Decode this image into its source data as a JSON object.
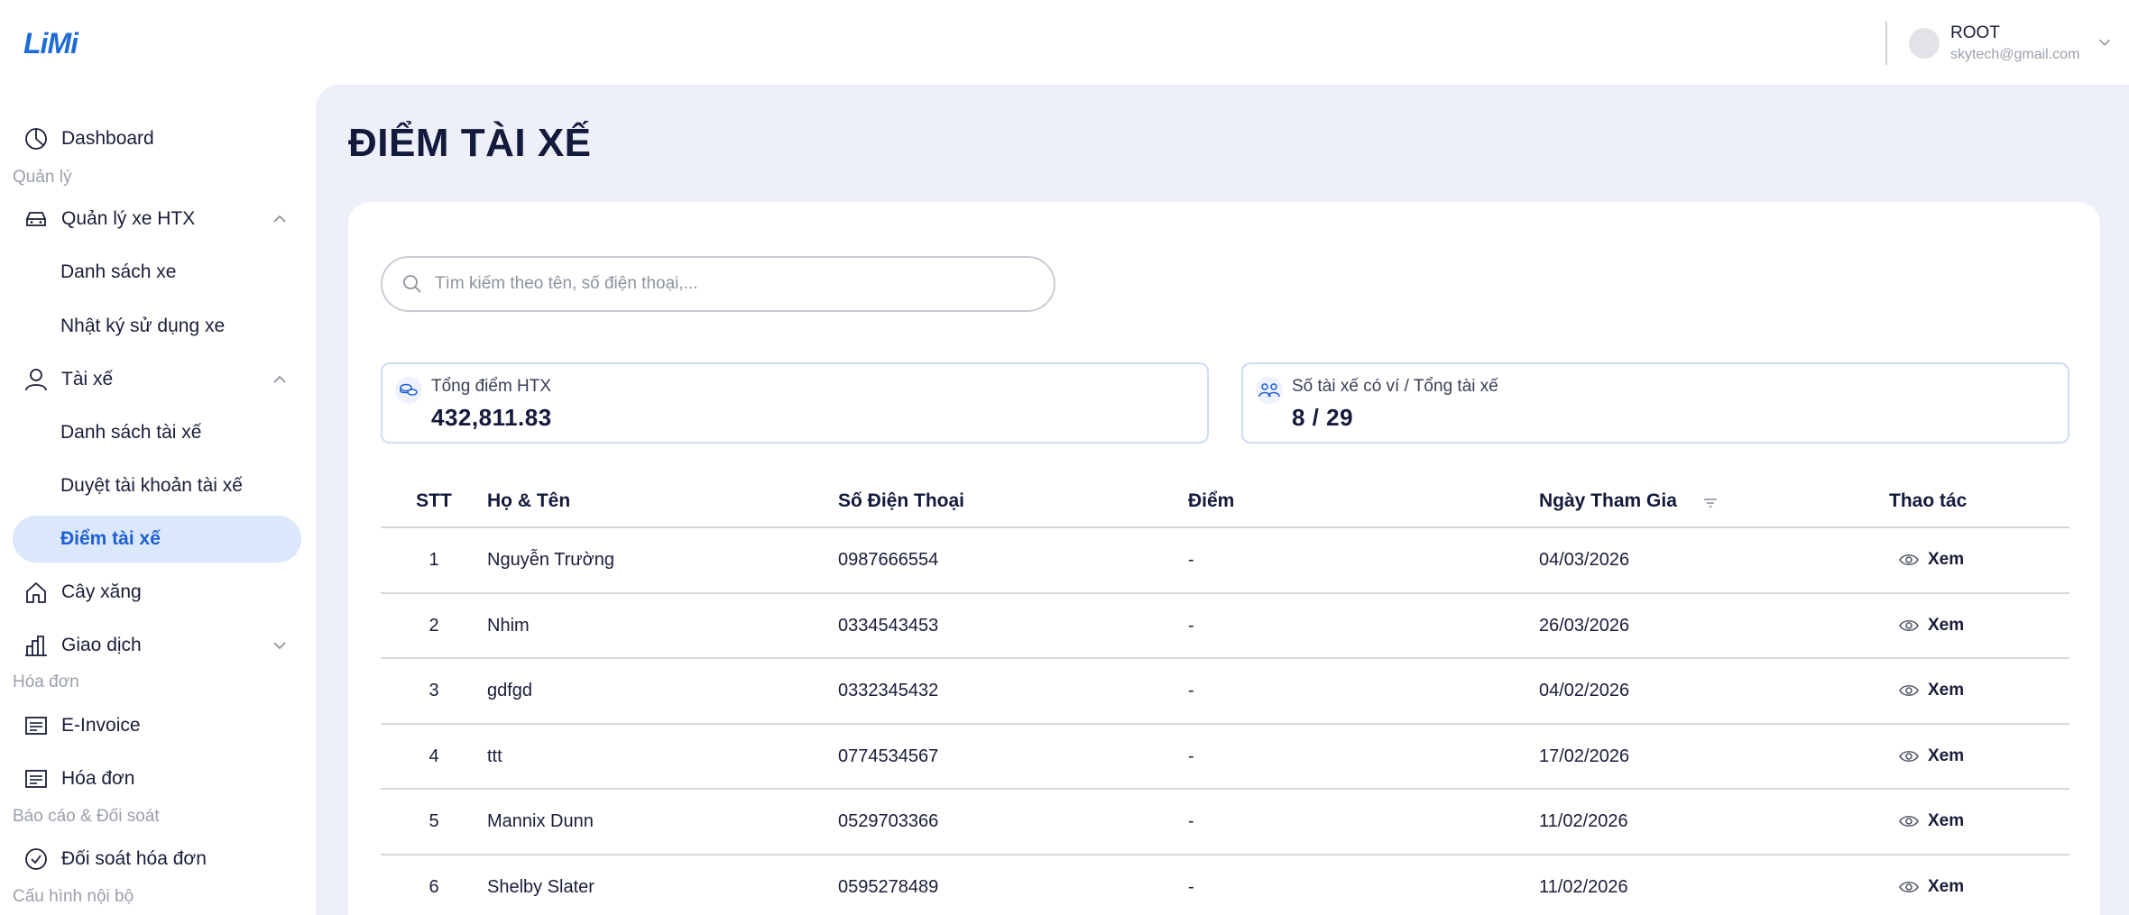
{
  "logo": "LiMi",
  "user": {
    "name": "ROOT",
    "email": "skytech@gmail.com"
  },
  "sidebar": {
    "dashboard": "Dashboard",
    "section_quanly": "Quản lý",
    "xe_group": "Quản lý xe HTX",
    "xe_list": "Danh sách xe",
    "xe_log": "Nhật ký sử dụng xe",
    "taixe_group": "Tài xế",
    "taixe_list": "Danh sách tài xế",
    "taixe_approve": "Duyệt tài khoản tài xế",
    "taixe_points": "Điểm tài xế",
    "caysang": "Cây xăng",
    "giaodich": "Giao dịch",
    "section_hoadon": "Hóa đơn",
    "einvoice": "E-Invoice",
    "hoadon": "Hóa đơn",
    "section_baocao": "Báo cáo & Đối soát",
    "doisoat": "Đối soát hóa đơn",
    "section_cauhinh": "Cấu hình nội bộ"
  },
  "page": {
    "title": "ĐIỂM TÀI XẾ"
  },
  "search": {
    "placeholder": "Tìm kiếm theo tên, số điện thoại,..."
  },
  "stats": {
    "total_label": "Tổng điểm HTX",
    "total_value": "432,811.83",
    "drivers_label": "Số tài xế có ví / Tổng tài xế",
    "drivers_value": "8 / 29"
  },
  "table": {
    "headers": {
      "stt": "STT",
      "name": "Họ & Tên",
      "phone": "Số Điện Thoại",
      "points": "Điểm",
      "date": "Ngày Tham Gia",
      "action": "Thao tác"
    },
    "rows": [
      {
        "stt": "1",
        "name": "Nguyễn Trường",
        "phone": "0987666554",
        "points": "-",
        "date": "04/03/2026",
        "action": "Xem"
      },
      {
        "stt": "2",
        "name": "Nhim",
        "phone": "0334543453",
        "points": "-",
        "date": "26/03/2026",
        "action": "Xem"
      },
      {
        "stt": "3",
        "name": "gdfgd",
        "phone": "0332345432",
        "points": "-",
        "date": "04/02/2026",
        "action": "Xem"
      },
      {
        "stt": "4",
        "name": "ttt",
        "phone": "0774534567",
        "points": "-",
        "date": "17/02/2026",
        "action": "Xem"
      },
      {
        "stt": "5",
        "name": "Mannix Dunn",
        "phone": "0529703366",
        "points": "-",
        "date": "11/02/2026",
        "action": "Xem"
      },
      {
        "stt": "6",
        "name": "Shelby Slater",
        "phone": "0595278489",
        "points": "-",
        "date": "11/02/2026",
        "action": "Xem"
      }
    ]
  },
  "colors": {
    "accent": "#1e5fd3",
    "active_bg": "#dbe8fb",
    "main_bg": "#edf0f8"
  }
}
